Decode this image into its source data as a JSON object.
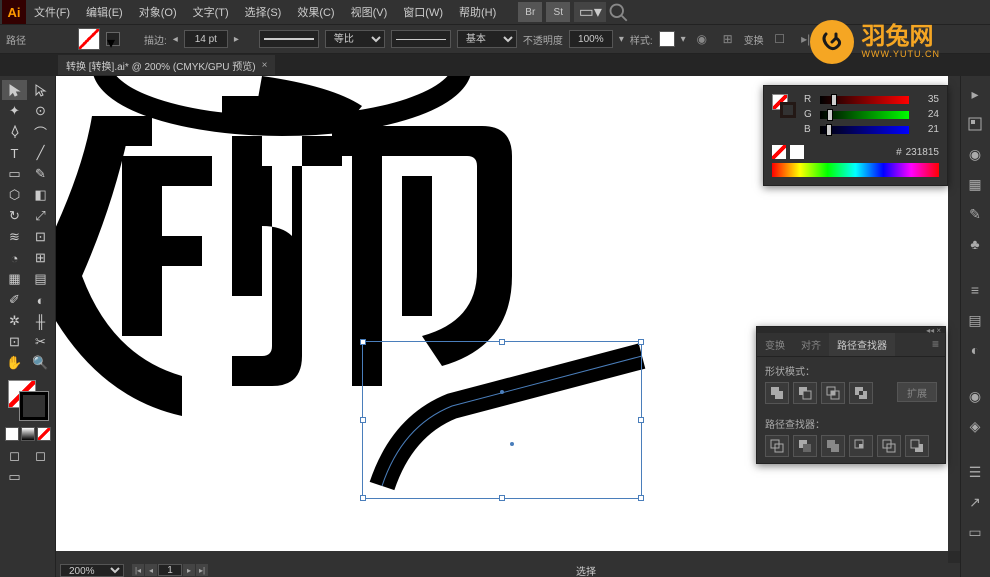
{
  "app": {
    "icon": "Ai"
  },
  "menubar": {
    "items": [
      "文件(F)",
      "编辑(E)",
      "对象(O)",
      "文字(T)",
      "选择(S)",
      "效果(C)",
      "视图(V)",
      "窗口(W)",
      "帮助(H)"
    ],
    "btn_br": "Br",
    "btn_st": "St"
  },
  "options": {
    "tool_label": "路径",
    "stroke_label": "描边:",
    "stroke_width": "14 pt",
    "uniform": "等比",
    "profile": "基本",
    "opacity_label": "不透明度",
    "opacity": "100%",
    "style_label": "样式:",
    "transform": "变换"
  },
  "tab": {
    "title": "转换  [转换].ai* @ 200% (CMYK/GPU 预览)"
  },
  "color_panel": {
    "r": {
      "label": "R",
      "value": "35"
    },
    "g": {
      "label": "G",
      "value": "24"
    },
    "b": {
      "label": "B",
      "value": "21"
    },
    "hex_label": "#",
    "hex": "231815"
  },
  "pathfinder": {
    "tabs": [
      "变换",
      "对齐",
      "路径查找器"
    ],
    "shape_mode_label": "形状模式：",
    "pathfinder_label": "路径查找器：",
    "expand": "扩展"
  },
  "status": {
    "zoom": "200%",
    "page": "1",
    "tool": "选择"
  },
  "watermark": {
    "text": "羽兔网",
    "url": "WWW.YUTU.CN"
  }
}
